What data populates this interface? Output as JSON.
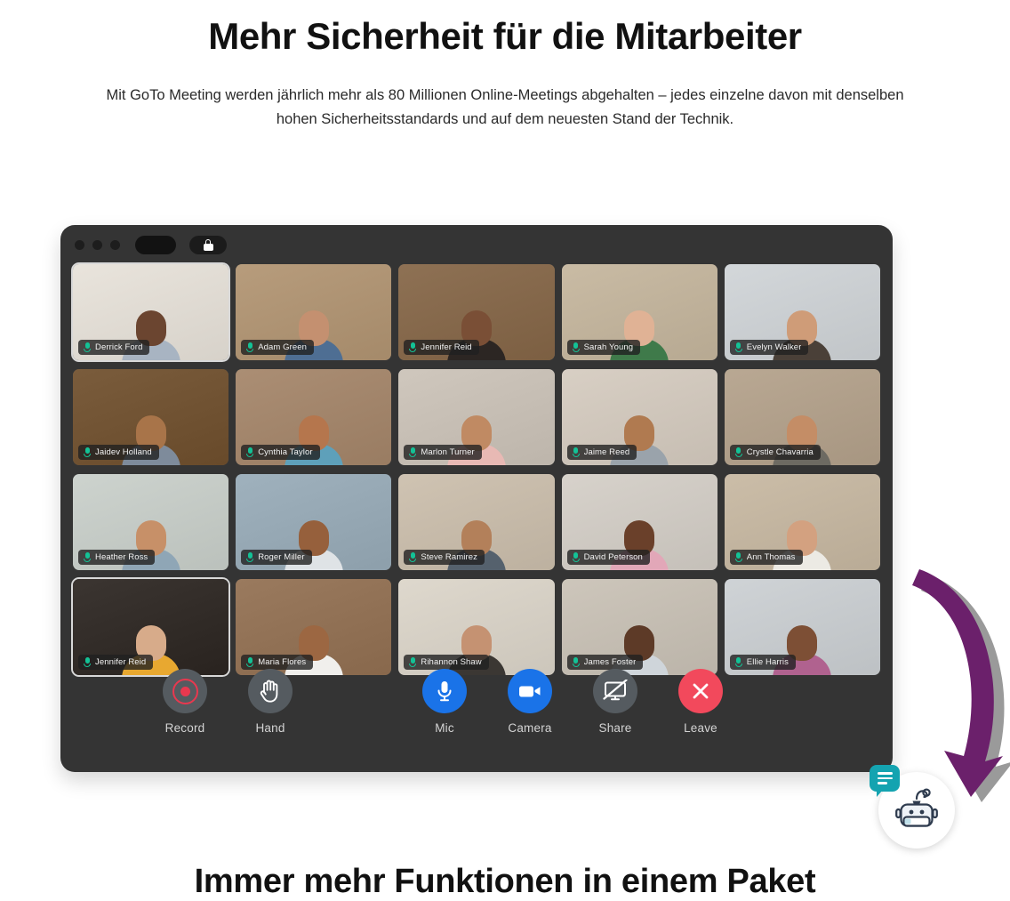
{
  "page": {
    "heading": "Mehr Sicherheit für die Mitarbeiter",
    "subheading": "Mit GoTo Meeting werden jährlich mehr als 80 Millionen Online-Meetings abgehalten – jedes einzelne davon mit denselben hohen Sicherheitsstandards und auf dem neuesten Stand der Technik.",
    "bottom_heading": "Immer mehr Funktionen in einem Paket",
    "background_color": "#ffffff",
    "text_color": "#111111"
  },
  "meeting_window": {
    "background_color": "#343434",
    "titlebar": {
      "dots": 3,
      "dot_color": "#1d1d1d",
      "pill_color": "#121212",
      "lock_icon": "lock-icon"
    },
    "grid": {
      "columns": 5,
      "rows": 4,
      "tiles": [
        {
          "name": "Derrick Ford",
          "mic": "mic-on",
          "highlighted": true,
          "bg": "#e9e4dc",
          "skin": "#6b4530",
          "shirt": "#a8b4c2"
        },
        {
          "name": "Adam Green",
          "mic": "mic-on",
          "highlighted": false,
          "bg": "#b79c7c",
          "skin": "#c49070",
          "shirt": "#4e6e93"
        },
        {
          "name": "Jennifer Reid",
          "mic": "mic-on",
          "highlighted": false,
          "bg": "#8e7154",
          "skin": "#7a4f36",
          "shirt": "#2c2623"
        },
        {
          "name": "Sarah Young",
          "mic": "mic-on",
          "highlighted": false,
          "bg": "#c9bba4",
          "skin": "#e0b295",
          "shirt": "#3f7a4a"
        },
        {
          "name": "Evelyn Walker",
          "mic": "mic-on",
          "highlighted": false,
          "bg": "#d3d7da",
          "skin": "#cf9c78",
          "shirt": "#4a4038"
        },
        {
          "name": "Jaidev Holland",
          "mic": "mic-on",
          "highlighted": false,
          "bg": "#7a5c3c",
          "skin": "#a87449",
          "shirt": "#7e8b9b"
        },
        {
          "name": "Cynthia Taylor",
          "mic": "mic-on",
          "highlighted": false,
          "bg": "#ab8e74",
          "skin": "#b5764d",
          "shirt": "#5ea0ba"
        },
        {
          "name": "Marlon Turner",
          "mic": "mic-on",
          "highlighted": false,
          "bg": "#cfc7bd",
          "skin": "#c08a63",
          "shirt": "#e8b9b4"
        },
        {
          "name": "Jaime Reed",
          "mic": "mic-on",
          "highlighted": false,
          "bg": "#d8cfc4",
          "skin": "#b07a50",
          "shirt": "#9aa3ab"
        },
        {
          "name": "Crystle Chavarria",
          "mic": "mic-on",
          "highlighted": false,
          "bg": "#b9a893",
          "skin": "#c48d66",
          "shirt": "#6d6a62"
        },
        {
          "name": "Heather Ross",
          "mic": "mic-on",
          "highlighted": false,
          "bg": "#cdd3ce",
          "skin": "#c79068",
          "shirt": "#8fa6b6"
        },
        {
          "name": "Roger Miller",
          "mic": "mic-on",
          "highlighted": false,
          "bg": "#9fb1bd",
          "skin": "#96603c",
          "shirt": "#dfe3e6"
        },
        {
          "name": "Steve Ramirez",
          "mic": "mic-on",
          "highlighted": false,
          "bg": "#cfc3b2",
          "skin": "#b3805a",
          "shirt": "#55616d"
        },
        {
          "name": "David Peterson",
          "mic": "mic-on",
          "highlighted": false,
          "bg": "#d7d2cb",
          "skin": "#6a402a",
          "shirt": "#e2a7b8"
        },
        {
          "name": "Ann Thomas",
          "mic": "mic-on",
          "highlighted": false,
          "bg": "#cbbda8",
          "skin": "#d3a180",
          "shirt": "#eceae4"
        },
        {
          "name": "Jennifer Reid",
          "mic": "mic-on",
          "highlighted": true,
          "bg": "#3b3531",
          "skin": "#d7ab8a",
          "shirt": "#e8a830"
        },
        {
          "name": "Maria Flores",
          "mic": "mic-on",
          "highlighted": false,
          "bg": "#9a7a5e",
          "skin": "#9c6742",
          "shirt": "#f0efec"
        },
        {
          "name": "Rihannon Shaw",
          "mic": "mic-on",
          "highlighted": false,
          "bg": "#ded8cd",
          "skin": "#c59272",
          "shirt": "#3b3733"
        },
        {
          "name": "James Foster",
          "mic": "mic-on",
          "highlighted": false,
          "bg": "#cdc6bb",
          "skin": "#5d3a27",
          "shirt": "#cfd5da"
        },
        {
          "name": "Ellie Harris",
          "mic": "mic-on",
          "highlighted": false,
          "bg": "#cfd3d6",
          "skin": "#7d4f35",
          "shirt": "#b0628f"
        }
      ]
    },
    "controls": {
      "left": [
        {
          "label": "Record",
          "icon": "record-icon",
          "style": "gray"
        },
        {
          "label": "Hand",
          "icon": "raise-hand-icon",
          "style": "gray"
        }
      ],
      "right": [
        {
          "label": "Mic",
          "icon": "microphone-icon",
          "style": "blue"
        },
        {
          "label": "Camera",
          "icon": "video-camera-icon",
          "style": "blue"
        },
        {
          "label": "Share",
          "icon": "screen-share-off-icon",
          "style": "gray"
        },
        {
          "label": "Leave",
          "icon": "close-x-icon",
          "style": "red"
        }
      ],
      "colors": {
        "blue": "#1a73e8",
        "red": "#f2495c",
        "gray": "#555b60",
        "record": "#e8384f"
      }
    }
  },
  "bot_widget": {
    "icon": "robot-icon",
    "badge_icon": "chat-bubble-icon",
    "badge_color": "#14a3b0",
    "background_color": "#ffffff"
  },
  "annotation_arrow": {
    "icon": "curved-arrow-icon",
    "color": "#6b206b",
    "shadow_color": "#9a9a9a",
    "direction": "down-left"
  }
}
